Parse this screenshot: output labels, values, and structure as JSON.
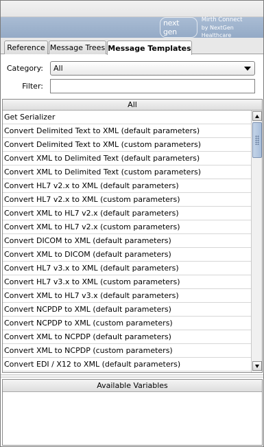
{
  "banner": {
    "logo_mark": "next gen",
    "product_title": "Mirth Connect",
    "product_sub": "by NextGen Healthcare"
  },
  "tabs": [
    {
      "label": "Reference",
      "active": false
    },
    {
      "label": "Message Trees",
      "active": false
    },
    {
      "label": "Message Templates",
      "active": true
    }
  ],
  "category": {
    "label": "Category:",
    "value": "All"
  },
  "filter": {
    "label": "Filter:",
    "value": ""
  },
  "list": {
    "header": "All",
    "items": [
      "Get Serializer",
      "Convert Delimited Text to XML (default parameters)",
      "Convert Delimited Text to XML (custom parameters)",
      "Convert XML to Delimited Text (default parameters)",
      "Convert XML to Delimited Text (custom parameters)",
      "Convert HL7 v2.x to XML (default parameters)",
      "Convert HL7 v2.x to XML (custom parameters)",
      "Convert XML to HL7 v2.x (default parameters)",
      "Convert XML to HL7 v2.x (custom parameters)",
      "Convert DICOM to XML (default parameters)",
      "Convert XML to DICOM (default parameters)",
      "Convert HL7 v3.x to XML (default parameters)",
      "Convert HL7 v3.x to XML (custom parameters)",
      "Convert XML to HL7 v3.x (default parameters)",
      "Convert NCPDP to XML (default parameters)",
      "Convert NCPDP to XML (custom parameters)",
      "Convert XML to NCPDP (default parameters)",
      "Convert XML to NCPDP (custom parameters)",
      "Convert EDI / X12 to XML (default parameters)"
    ]
  },
  "variables": {
    "header": "Available Variables"
  },
  "colors": {
    "banner": "#9fb3cd",
    "selected_tab": "#ffffff",
    "scroll_thumb": "#b6c8e0"
  }
}
